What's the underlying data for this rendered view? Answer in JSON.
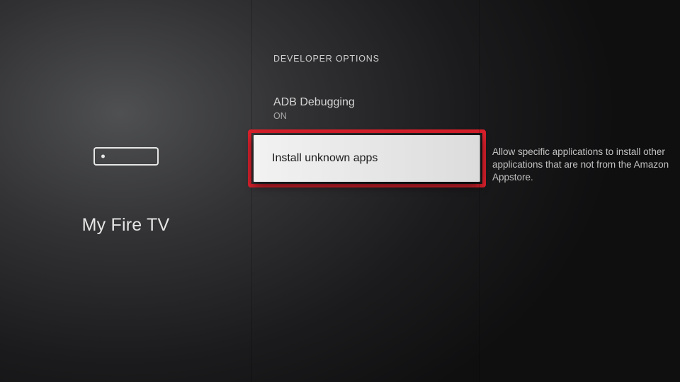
{
  "left": {
    "title": "My Fire TV"
  },
  "mid": {
    "section_header": "DEVELOPER OPTIONS",
    "items": [
      {
        "title": "ADB Debugging",
        "subtitle": "ON"
      },
      {
        "title": "Install unknown apps"
      }
    ]
  },
  "right": {
    "description": "Allow specific applications to install other applications that are not from the Amazon Appstore."
  }
}
